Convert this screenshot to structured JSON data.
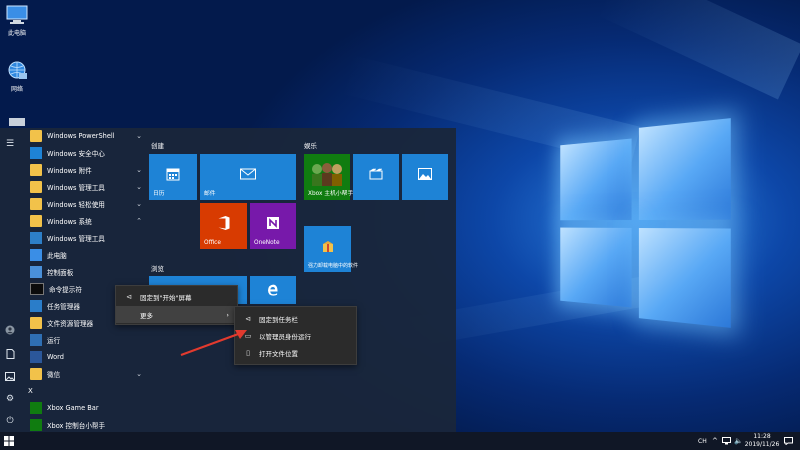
{
  "desktop": {
    "icons": [
      {
        "label": "此电脑"
      },
      {
        "label": "网络"
      }
    ]
  },
  "start_menu": {
    "app_list": [
      {
        "label": "Windows PowerShell",
        "icon": "folder-icon",
        "chevron": "⌄"
      },
      {
        "label": "Windows 安全中心",
        "icon": "shield-icon",
        "chevron": ""
      },
      {
        "label": "Windows 附件",
        "icon": "folder-icon",
        "chevron": "⌄"
      },
      {
        "label": "Windows 管理工具",
        "icon": "folder-icon",
        "chevron": "⌄"
      },
      {
        "label": "Windows 轻松使用",
        "icon": "folder-icon",
        "chevron": "⌄"
      },
      {
        "label": "Windows 系统",
        "icon": "folder-icon",
        "chevron": "⌃"
      },
      {
        "label": "Windows 管理工具",
        "icon": "admin-tools-icon",
        "chevron": ""
      },
      {
        "label": "此电脑",
        "icon": "computer-icon",
        "chevron": ""
      },
      {
        "label": "控制面板",
        "icon": "control-panel-icon",
        "chevron": ""
      },
      {
        "label": "命令提示符",
        "icon": "cmd-icon",
        "chevron": ""
      },
      {
        "label": "任务管理器",
        "icon": "task-manager-icon",
        "chevron": ""
      },
      {
        "label": "文件资源管理器",
        "icon": "folder-icon",
        "chevron": ""
      },
      {
        "label": "运行",
        "icon": "run-icon",
        "chevron": ""
      },
      {
        "label": "Word",
        "icon": "word-icon",
        "chevron": ""
      },
      {
        "label": "微信",
        "icon": "folder-icon",
        "chevron": "⌄"
      },
      {
        "label": "X",
        "icon": "",
        "chevron": "",
        "section": true
      },
      {
        "label": "Xbox Game Bar",
        "icon": "xbox-icon",
        "chevron": ""
      },
      {
        "label": "Xbox 控制台小帮手",
        "icon": "xbox-icon",
        "chevron": ""
      }
    ],
    "groups": {
      "create": "创建",
      "entertain": "娱乐",
      "browse": "浏览"
    },
    "tiles": {
      "calendar": "日历",
      "mail": "邮件",
      "office": "Office",
      "onenote": "OneNote",
      "xbox": "Xbox 主机小帮手",
      "movies": "",
      "photos": "",
      "kingsoft": "强力卸载电脑中的软件"
    }
  },
  "context_menu_1": {
    "items": [
      {
        "label": "固定到\"开始\"屏幕",
        "icon": "pin-icon"
      },
      {
        "label": "更多",
        "icon": "",
        "arrow": "›"
      }
    ]
  },
  "context_menu_2": {
    "items": [
      {
        "label": "固定到任务栏",
        "icon": "pin-icon"
      },
      {
        "label": "以管理员身份运行",
        "icon": "admin-run-icon"
      },
      {
        "label": "打开文件位置",
        "icon": "file-icon"
      }
    ]
  },
  "taskbar": {
    "ime": "CH",
    "time": "11:28",
    "date": "2019/11/26"
  },
  "colors": {
    "tile_blue": "#1e83d6",
    "office_orange": "#d83b01",
    "onenote_purple": "#7719aa",
    "xbox_green": "#107c10",
    "annotation_red": "#e23a2e"
  }
}
